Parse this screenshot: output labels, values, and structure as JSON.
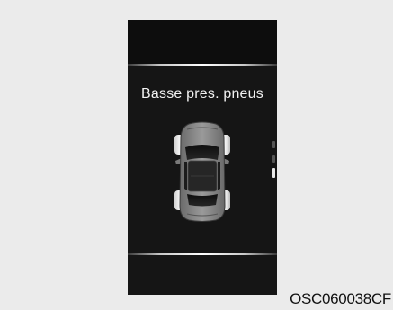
{
  "display": {
    "message": "Basse pres. pneus",
    "illustration": "car-top-view-icon",
    "page_indicator": {
      "pages": 3,
      "active": 3
    }
  },
  "figure_code": "OSC060038CF"
}
